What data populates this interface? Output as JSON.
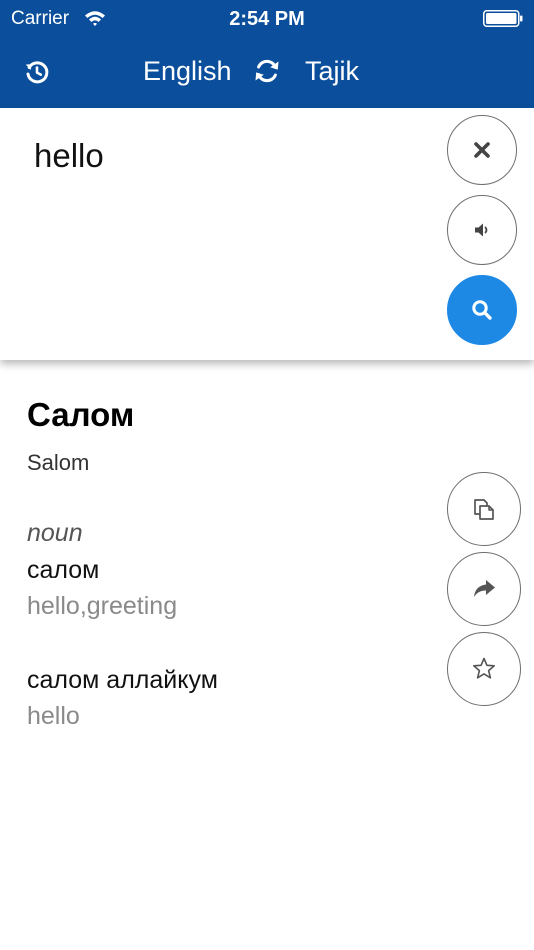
{
  "status_bar": {
    "carrier": "Carrier",
    "time": "2:54 PM"
  },
  "nav": {
    "history_icon": "history-icon",
    "source_language": "English",
    "swap_icon": "swap-icon",
    "target_language": "Tajik"
  },
  "input": {
    "text": "hello",
    "buttons": [
      "clear",
      "speak",
      "search"
    ]
  },
  "result": {
    "headword": "Салом",
    "transliteration": "Salom",
    "part_of_speech": "noun",
    "entries": [
      {
        "word": "салом",
        "gloss": "hello,greeting"
      },
      {
        "word": "салом аллайкум",
        "gloss": "hello"
      }
    ],
    "actions": [
      "copy",
      "share",
      "favorite"
    ]
  },
  "colors": {
    "header_blue": "#0b4f9c",
    "search_button_blue": "#1e88e5",
    "gloss_gray": "#8a8a8a"
  }
}
